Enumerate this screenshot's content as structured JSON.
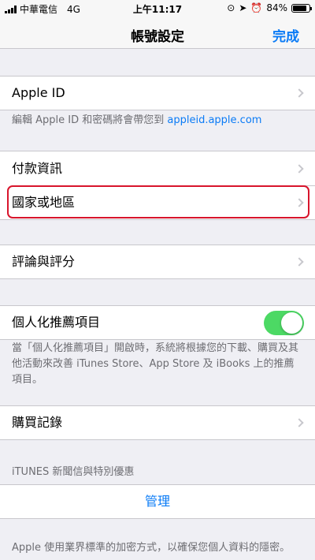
{
  "status_bar": {
    "carrier": "中華電信",
    "network": "4G",
    "time": "上午11:17",
    "battery": "84%",
    "battery_level": 0.84
  },
  "nav": {
    "title": "帳號設定",
    "done": "完成"
  },
  "rows": {
    "apple_id": "Apple ID",
    "apple_id_note_prefix": "編輯 Apple ID 和密碼將會帶您到 ",
    "apple_id_note_link": "appleid.apple.com",
    "payment": "付款資訊",
    "country": "國家或地區",
    "ratings": "評論與評分",
    "personalized": "個人化推薦項目",
    "personalized_enabled": true,
    "personalized_note": "當「個人化推薦項目」開啟時，系統將根據您的下載、購買及其他活動來改善 iTunes Store、App Store 及 iBooks 上的推薦項目。",
    "purchase_history": "購買記錄",
    "itunes_header": "iTUNES 新聞信與特別優惠",
    "manage": "管理",
    "footer": "Apple 使用業界標準的加密方式，以確保您個人資料的隱密。"
  },
  "colors": {
    "accent": "#0a7bf6",
    "toggle_on": "#4cd964",
    "highlight": "#d8152c"
  }
}
